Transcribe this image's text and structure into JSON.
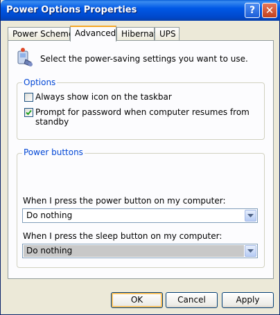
{
  "window": {
    "title": "Power Options Properties"
  },
  "titlebar": {
    "help_label": "?",
    "close_label": "✕"
  },
  "tabs": [
    {
      "label": "Power Schemes"
    },
    {
      "label": "Advanced"
    },
    {
      "label": "Hibernate"
    },
    {
      "label": "UPS"
    }
  ],
  "intro": {
    "text": "Select the power-saving settings you want to use.",
    "icon": "power-settings-icon"
  },
  "options": {
    "title": "Options",
    "items": [
      {
        "label": "Always show icon on the taskbar",
        "checked": false
      },
      {
        "label": "Prompt for password when computer resumes from standby",
        "checked": true
      }
    ]
  },
  "power_buttons": {
    "title": "Power buttons",
    "power_label": "When I press the power button on my computer:",
    "power_value": "Do nothing",
    "sleep_label": "When I press the sleep button on my computer:",
    "sleep_value": "Do nothing"
  },
  "footer": {
    "ok": "OK",
    "cancel": "Cancel",
    "apply": "Apply"
  },
  "colors": {
    "titlebar": "#0058e6",
    "group_title": "#0046d5",
    "active_tab_accent": "#f5a623"
  }
}
